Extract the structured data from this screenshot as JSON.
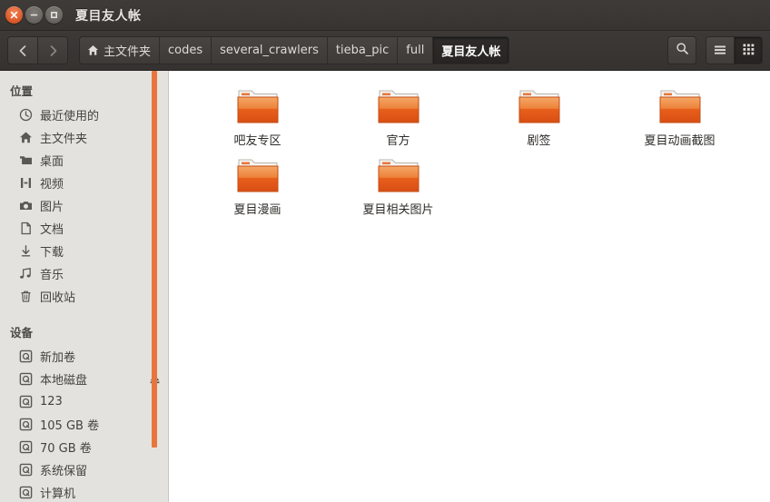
{
  "window": {
    "title": "夏目友人帐",
    "controls": {
      "close": "close-button",
      "minimize": "minimize-button",
      "maximize": "maximize-button"
    }
  },
  "toolbar": {
    "back_label": "后退",
    "forward_label": "前进",
    "breadcrumbs": [
      {
        "label": "主文件夹",
        "icon": "home-icon",
        "active": false
      },
      {
        "label": "codes",
        "active": false
      },
      {
        "label": "several_crawlers",
        "active": false
      },
      {
        "label": "tieba_pic",
        "active": false
      },
      {
        "label": "full",
        "active": false
      },
      {
        "label": "夏目友人帐",
        "active": true
      }
    ],
    "search_label": "搜索",
    "list_view_label": "列表视图",
    "grid_view_label": "图标视图",
    "active_view": "grid"
  },
  "sidebar": {
    "sections": [
      {
        "header": "位置",
        "items": [
          {
            "label": "最近使用的",
            "icon": "clock-icon"
          },
          {
            "label": "主文件夹",
            "icon": "home-icon"
          },
          {
            "label": "桌面",
            "icon": "folder-icon"
          },
          {
            "label": "视频",
            "icon": "film-icon"
          },
          {
            "label": "图片",
            "icon": "camera-icon"
          },
          {
            "label": "文档",
            "icon": "document-icon"
          },
          {
            "label": "下载",
            "icon": "download-icon"
          },
          {
            "label": "音乐",
            "icon": "music-icon"
          },
          {
            "label": "回收站",
            "icon": "trash-icon"
          }
        ]
      },
      {
        "header": "设备",
        "items": [
          {
            "label": "新加卷",
            "icon": "drive-icon"
          },
          {
            "label": "本地磁盘",
            "icon": "drive-icon",
            "eject": true
          },
          {
            "label": "123",
            "icon": "drive-icon"
          },
          {
            "label": "105 GB 卷",
            "icon": "drive-icon"
          },
          {
            "label": "70 GB 卷",
            "icon": "drive-icon"
          },
          {
            "label": "系统保留",
            "icon": "drive-icon"
          },
          {
            "label": "计算机",
            "icon": "drive-icon"
          }
        ]
      }
    ]
  },
  "content": {
    "items": [
      {
        "name": "吧友专区",
        "icon": "folder-icon"
      },
      {
        "name": "官方",
        "icon": "folder-icon"
      },
      {
        "name": "剧签",
        "icon": "folder-icon"
      },
      {
        "name": "夏目动画截图",
        "icon": "folder-icon"
      },
      {
        "name": "夏目漫画",
        "icon": "folder-icon"
      },
      {
        "name": "夏目相关图片",
        "icon": "folder-icon"
      }
    ]
  },
  "colors": {
    "accent_orange": "#e8763c",
    "titlebar": "#3b3835",
    "sidebar_bg": "#e4e2de",
    "content_bg": "#ffffff",
    "folder_orange": "#e8601c",
    "close_button": "#de5a2a"
  }
}
